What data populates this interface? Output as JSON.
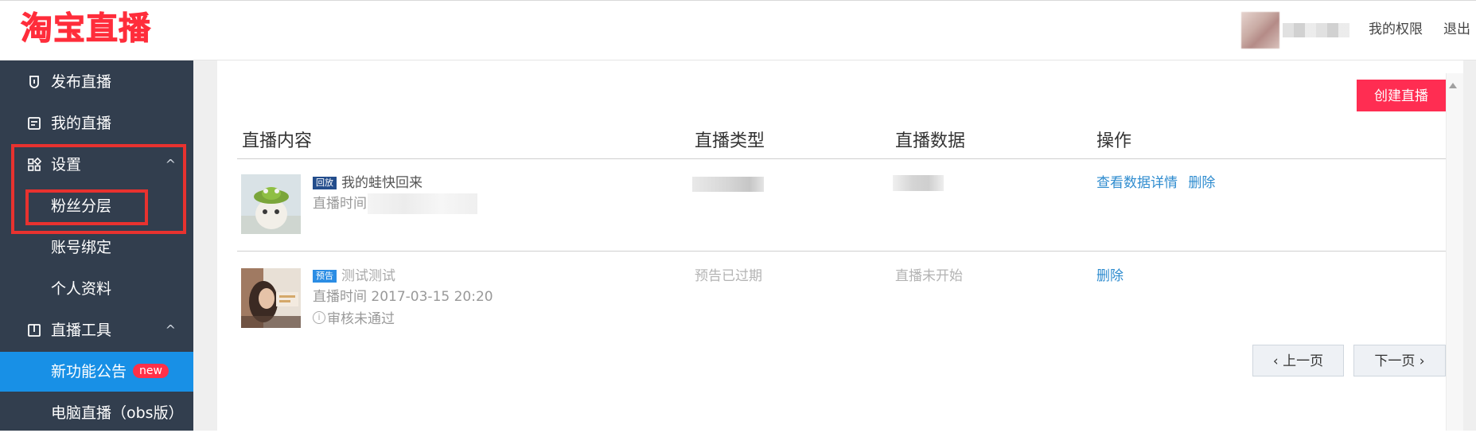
{
  "header": {
    "logo_text": "淘宝直播",
    "links": {
      "permissions": "我的权限",
      "logout": "退出"
    }
  },
  "sidebar": {
    "items": [
      {
        "label": "发布直播",
        "icon": "bookmark-icon"
      },
      {
        "label": "我的直播",
        "icon": "document-icon"
      },
      {
        "label": "设置",
        "icon": "grid-icon",
        "expanded": true
      },
      {
        "label": "粉丝分层"
      },
      {
        "label": "账号绑定"
      },
      {
        "label": "个人资料"
      },
      {
        "label": "直播工具",
        "icon": "book-icon",
        "expanded": true
      },
      {
        "label": "新功能公告",
        "badge": "new",
        "active": true
      },
      {
        "label": "电脑直播（obs版）"
      }
    ],
    "chevron": "^"
  },
  "main": {
    "create_button": "创建直播",
    "columns": [
      "直播内容",
      "直播类型",
      "直播数据",
      "操作"
    ],
    "rows": [
      {
        "tag": "回放",
        "tag_color": "#234d8c",
        "title": "我的蛙快回来",
        "time_label": "直播时间",
        "actions": [
          "查看数据详情",
          "删除"
        ]
      },
      {
        "tag": "预告",
        "tag_color": "#2b8de4",
        "title": "测试测试",
        "time_label": "直播时间 2017-03-15 20:20",
        "status": "审核未通过",
        "type": "预告已过期",
        "data": "直播未开始",
        "actions": [
          "删除"
        ]
      }
    ],
    "pager": {
      "prev": "上一页",
      "next": "下一页"
    }
  },
  "colors": {
    "brand_red": "#ff2d3b",
    "sidebar_bg": "#323e4e",
    "active_blue": "#1890e6",
    "link_blue": "#2f8ccf",
    "create_button": "#ff2d52",
    "highlight_red": "#e8322f"
  }
}
